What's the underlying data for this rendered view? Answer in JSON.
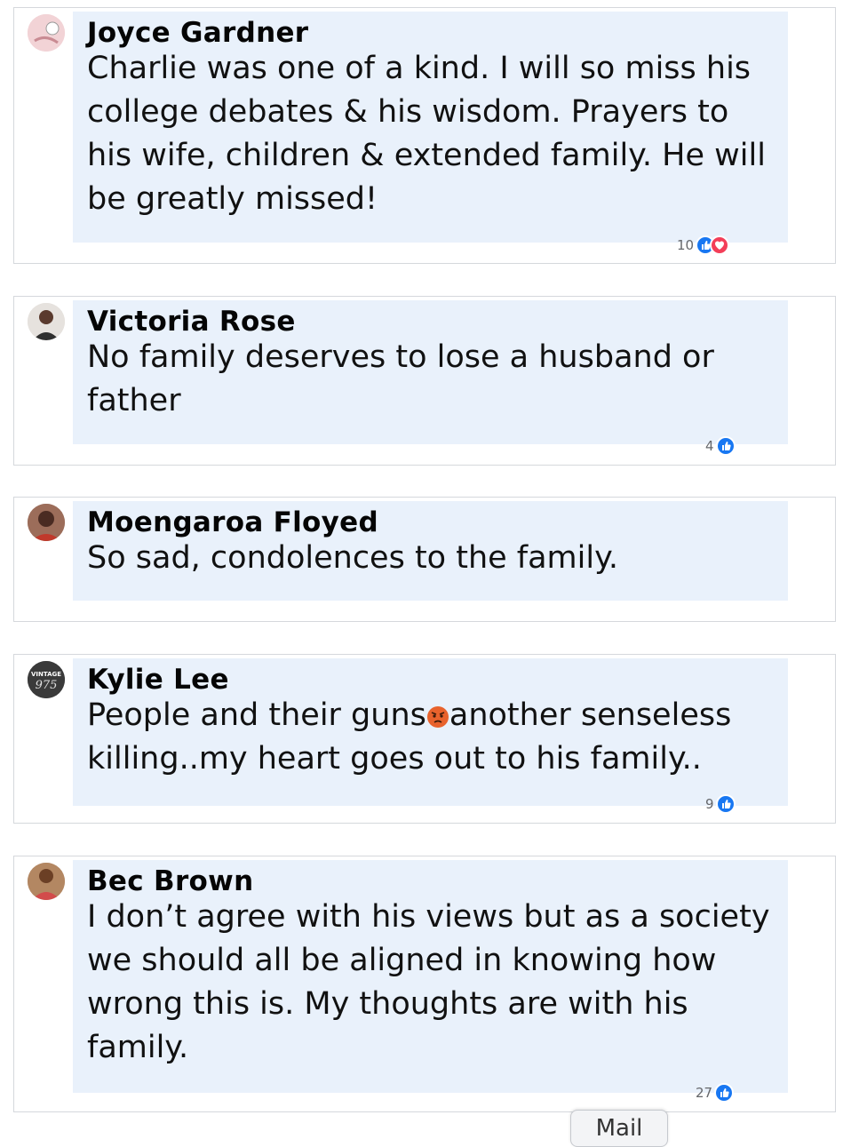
{
  "comments": [
    {
      "author": "Joyce Gardner",
      "text": "Charlie was one of a kind. I will so miss his college debates & his wisdom. Prayers to his wife, children & extended family. He will be greatly missed!",
      "reaction_count": "10",
      "reactions": [
        "like-icon",
        "love-icon"
      ]
    },
    {
      "author": "Victoria Rose",
      "text": "No family deserves to lose a husband or father",
      "reaction_count": "4",
      "reactions": [
        "like-icon"
      ]
    },
    {
      "author": "Moengaroa Floyed",
      "text": "So sad, condolences to the family.",
      "reaction_count": "",
      "reactions": []
    },
    {
      "author": "Kylie Lee",
      "text_before_emoji": "People and their guns",
      "emoji": "angry-face-emoji",
      "text_after_emoji": "another senseless killing..my heart goes out to his family..",
      "reaction_count": "9",
      "reactions": [
        "like-icon"
      ],
      "avatar_text": "VINTAGE 975"
    },
    {
      "author": "Bec Brown",
      "text": "I don’t agree with his views but as a society we should all be aligned in knowing how wrong this is. My thoughts are with his family.",
      "reaction_count": "27",
      "reactions": [
        "like-icon"
      ]
    }
  ],
  "bottom_tab": {
    "label": "Mail"
  },
  "colors": {
    "bubble": "#e9f1fb",
    "like": "#1877f2",
    "love": "#f33e58",
    "card_border": "#d5d8dc"
  }
}
